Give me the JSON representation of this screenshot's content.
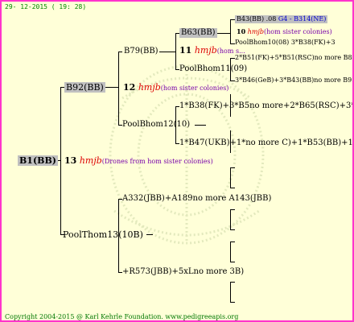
{
  "header": {
    "date": "29- 12-2015 ( 19: 28)"
  },
  "root": {
    "name": "B1(BB)",
    "num": "13",
    "station": "hmjb",
    "note": "(Drones from hom sister colonies)"
  },
  "gen1": {
    "mother": "B92(BB)",
    "num": "12",
    "station": "hmjb",
    "note": "(hom sister colonies)",
    "father": "PoolThom13(10B)"
  },
  "gen2": {
    "b79": "B79(BB)",
    "bhom12": "PoolBhom12(10)",
    "t13a": "A332(JBB)+A189no more A143(JBB)",
    "t13b": "+R573(JBB)+5xLno more 3B)"
  },
  "gen3": {
    "b63": "B63(BB)",
    "num": "11",
    "station": "hmjb",
    "note": "(hom s...",
    "bhom11": "PoolBhom11(09)",
    "p12a": "1*B38(FK)+3*B5no more+2*B65(RSC)+3*B29",
    "p12b": "1*B47(UKB)+1*no more C)+1*B53(BB)+1*A"
  },
  "gen4": {
    "b43": "B43(BB) .08",
    "g4": "G4 - B314(NE)",
    "num": "10",
    "station": "hmjb",
    "note": "(hom sister colonies)",
    "bhom10": "PoolBhom10(08) 3*B38(FK)+3",
    "p11a": "2*B51(FK)+5*B51(RSC)no more B86",
    "p11b": "3*B46(GeB)+3*B43(BB)no more B95(A"
  },
  "footer": {
    "text": "Copyright 2004-2015 @ Karl Kehrle Foundation.   www.pedigreeapis.org"
  }
}
